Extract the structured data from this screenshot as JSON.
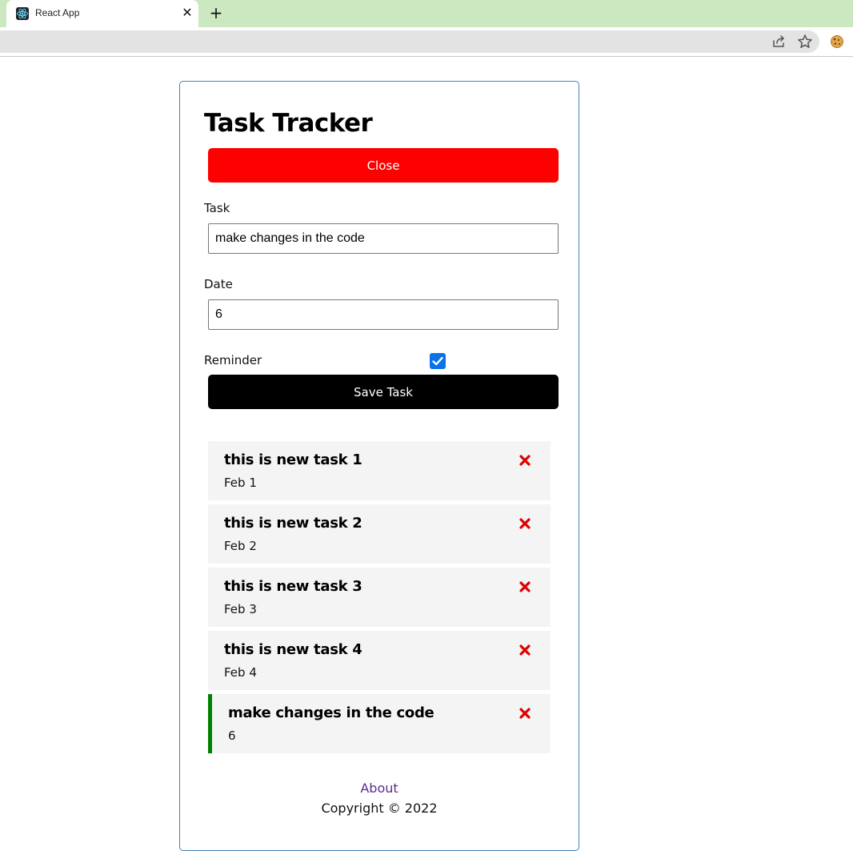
{
  "browser": {
    "tab_title": "React App",
    "tab_close": "✕",
    "new_tab": "+",
    "icons": [
      "react-favicon-icon",
      "share-icon",
      "star-icon",
      "cookie-extension-icon"
    ]
  },
  "app": {
    "title": "Task Tracker",
    "close_button": "Close",
    "close_button_color": "#ff0000",
    "form": {
      "task_label": "Task",
      "task_value": "make changes in the code",
      "date_label": "Date",
      "date_value": "6",
      "reminder_label": "Reminder",
      "reminder_checked": true,
      "save_button": "Save Task"
    },
    "tasks": [
      {
        "text": "this is new task 1",
        "day": "Feb 1",
        "reminder": false
      },
      {
        "text": "this is new task 2",
        "day": "Feb 2",
        "reminder": false
      },
      {
        "text": "this is new task 3",
        "day": "Feb 3",
        "reminder": false
      },
      {
        "text": "this is new task 4",
        "day": "Feb 4",
        "reminder": false
      },
      {
        "text": "make changes in the code",
        "day": "6",
        "reminder": true
      }
    ],
    "reminder_color": "#008000",
    "delete_icon_color": "#e00000",
    "footer": {
      "about_link": "About",
      "copyright": "Copyright © 2022"
    }
  }
}
